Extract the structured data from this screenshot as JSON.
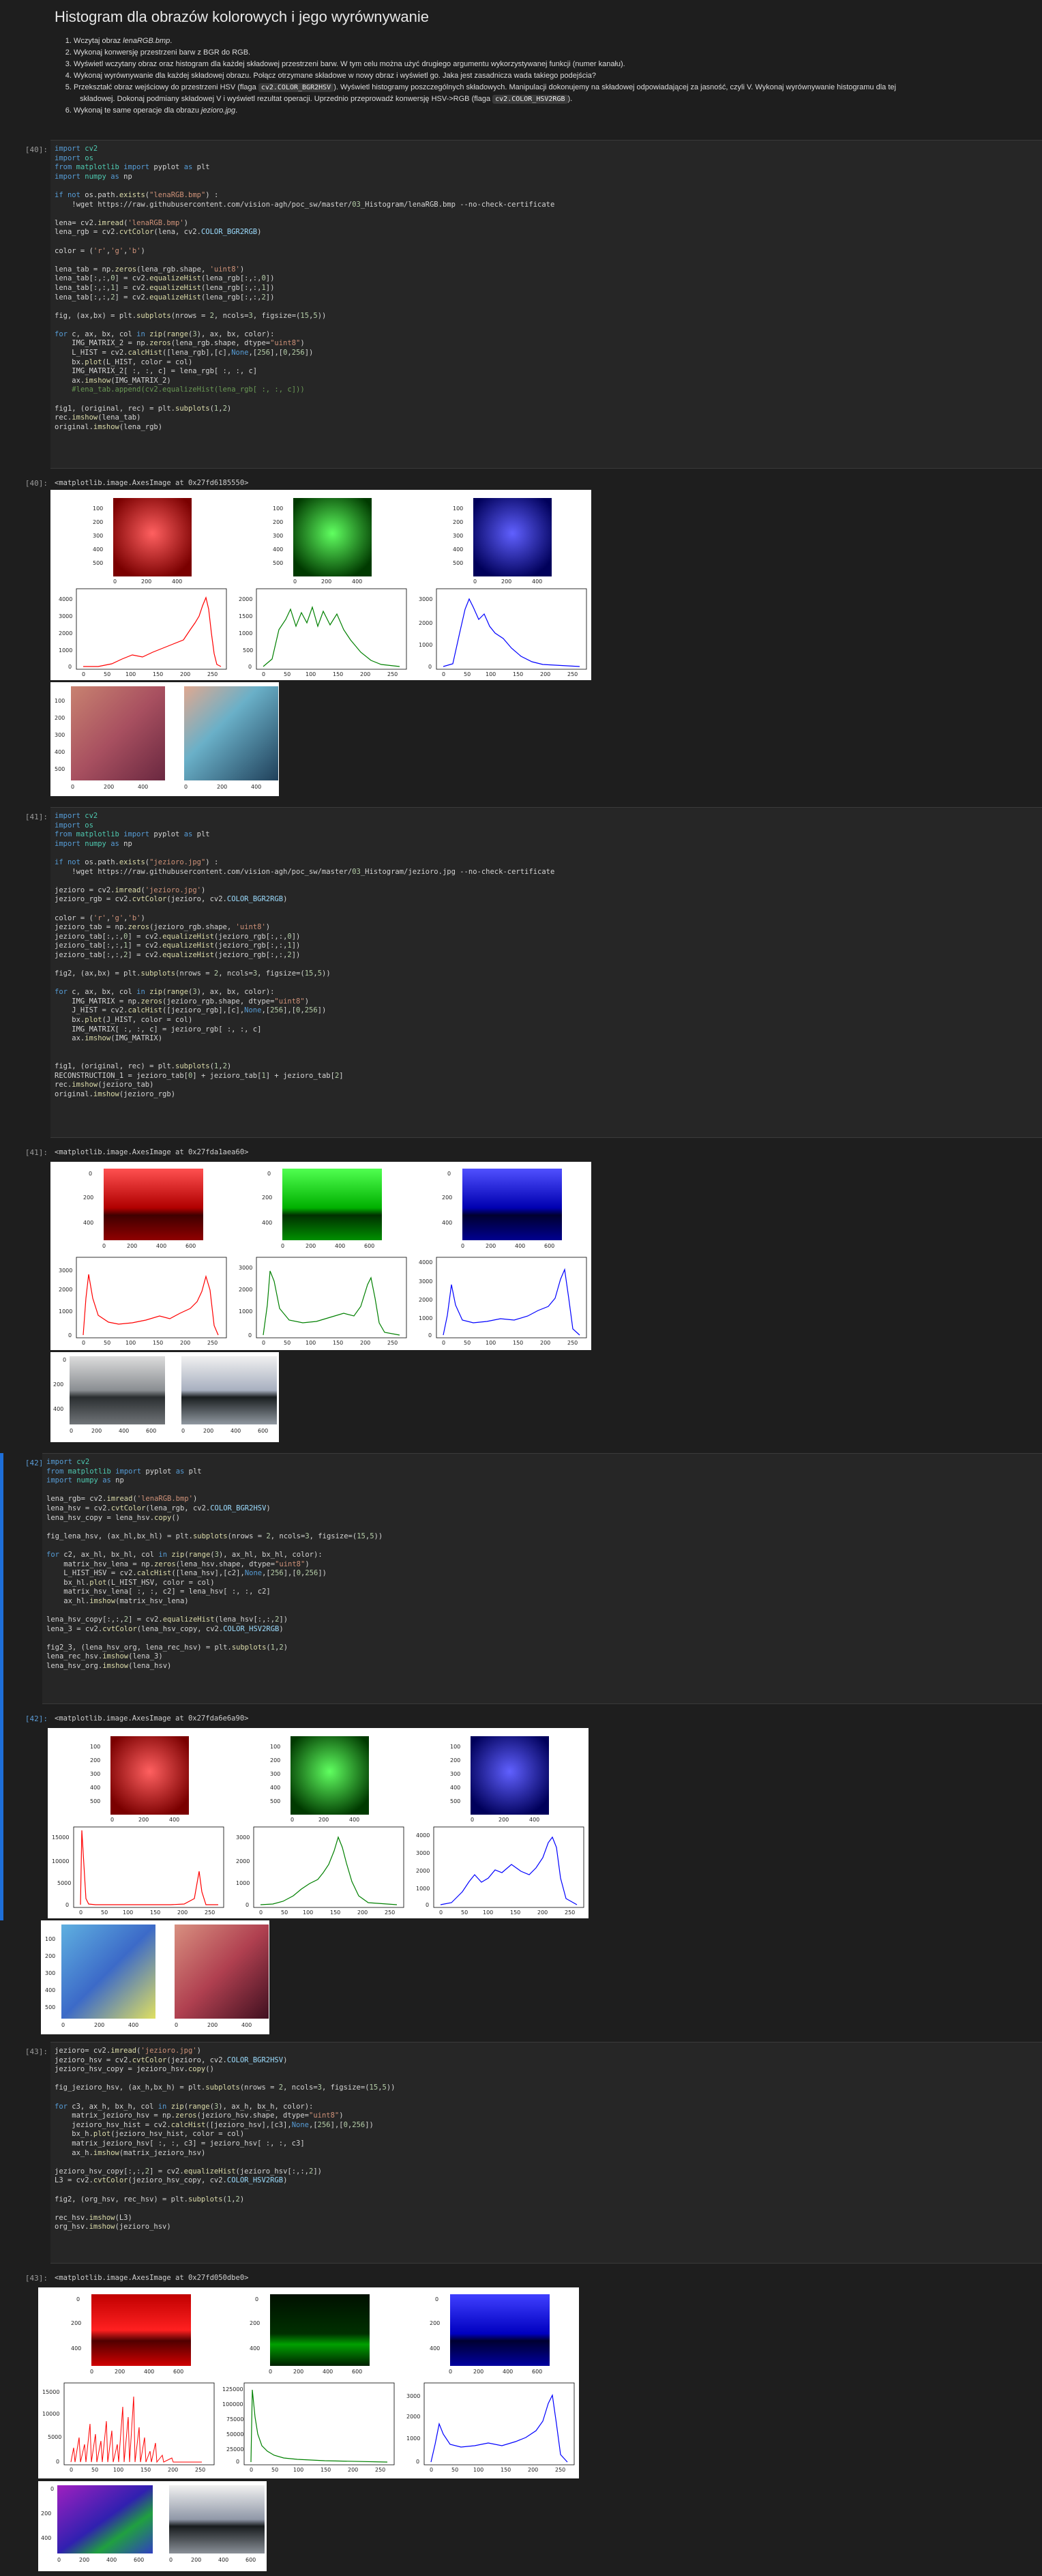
{
  "title": "Histogram dla obrazów kolorowych i jego wyrównywanie",
  "instructions": [
    "Wczytaj obraz lenaRGB.bmp.",
    "Wykonaj konwersję przestrzeni barw z BGR do RGB.",
    "Wyświetl wczytany obraz oraz histogram dla każdej składowej przestrzeni barw. W tym celu można użyć drugiego argumentu wykorzystywanej funkcji (numer kanału).",
    "Wykonaj wyrównywanie dla każdej składowej obrazu. Połącz otrzymane składowe w nowy obraz i wyświetl go. Jaka jest zasadnicza wada takiego podejścia?",
    "Przekształć obraz wejściowy do przestrzeni HSV (flaga cv2.COLOR_BGR2HSV ). Wyświetl histogramy poszczególnych składowych. Manipulacji dokonujemy na składowej odpowiadającej za jasność, czyli V. Wykonaj wyrównywanie histogramu dla tej składowej. Dokonaj podmiany składowej V i wyświetl rezultat operacji. Uprzednio przeprowadź konwersję HSV->RGB (flaga cv2.COLOR_HSV2RGB ).",
    "Wykonaj te same operacje dla obrazu jezioro.jpg."
  ],
  "cells": [
    {
      "prompt": "[40]:",
      "output": "<matplotlib.image.AxesImage at 0x27fd6185550>"
    },
    {
      "prompt": "[41]:",
      "output": "<matplotlib.image.AxesImage at 0x27fda1aea60>"
    },
    {
      "prompt": "[42]:",
      "output": "<matplotlib.image.AxesImage at 0x27fda6e6a90>"
    },
    {
      "prompt": "[43]:",
      "output": "<matplotlib.image.AxesImage at 0x27fd050dbe0>"
    }
  ],
  "colors": {
    "background": "#1e1e1e",
    "code_bg": "#262626",
    "active": "#1e6fd9",
    "red": "#ff0000",
    "green": "#008000",
    "blue": "#0000ff"
  },
  "tick_labels": {
    "lena_img_y": [
      "100",
      "200",
      "300",
      "400",
      "500"
    ],
    "lena_img_x": [
      "0",
      "200",
      "400"
    ],
    "hist_x": [
      "0",
      "50",
      "100",
      "150",
      "200",
      "250"
    ],
    "lake_img_x": [
      "0",
      "200",
      "400",
      "600"
    ]
  }
}
